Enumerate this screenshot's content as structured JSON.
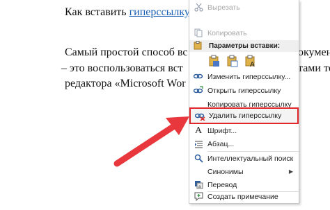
{
  "document": {
    "line1_text": "Как вставить ",
    "line1_link": "гиперссылку",
    "line2": "Самый простой способ вс",
    "line2_tail": "окумент",
    "line3": "– это воспользоваться вст",
    "line3_tail": "тами те",
    "line4": "редактора «Microsoft Wor"
  },
  "context_menu": {
    "cut": "Вырезать",
    "copy": "Копировать",
    "paste_options_header": "Параметры вставки:",
    "edit_hyperlink": "Изменить гиперссылку...",
    "open_hyperlink": "Открыть гиперссылку",
    "copy_hyperlink": "Копировать гиперссылку",
    "remove_hyperlink": "Удалить гиперссылку",
    "font": "Шрифт...",
    "paragraph": "Абзац...",
    "smart_lookup": "Интеллектуальный поиск",
    "synonyms": "Синонимы",
    "translate": "Перевод",
    "new_comment": "Создать примечание"
  },
  "icons": {
    "cut": "scissors-icon",
    "copy": "copy-icon",
    "paste": "clipboard-icon",
    "edit_hyperlink": "link-edit-icon",
    "open_hyperlink": "link-open-icon",
    "remove_hyperlink": "link-remove-icon",
    "font": "font-icon",
    "paragraph": "paragraph-icon",
    "smart_lookup": "search-icon",
    "translate": "translate-icon",
    "new_comment": "comment-icon"
  },
  "colors": {
    "highlight_border": "#e2262b",
    "arrow": "#e8383d",
    "link": "#1a5fb4"
  }
}
